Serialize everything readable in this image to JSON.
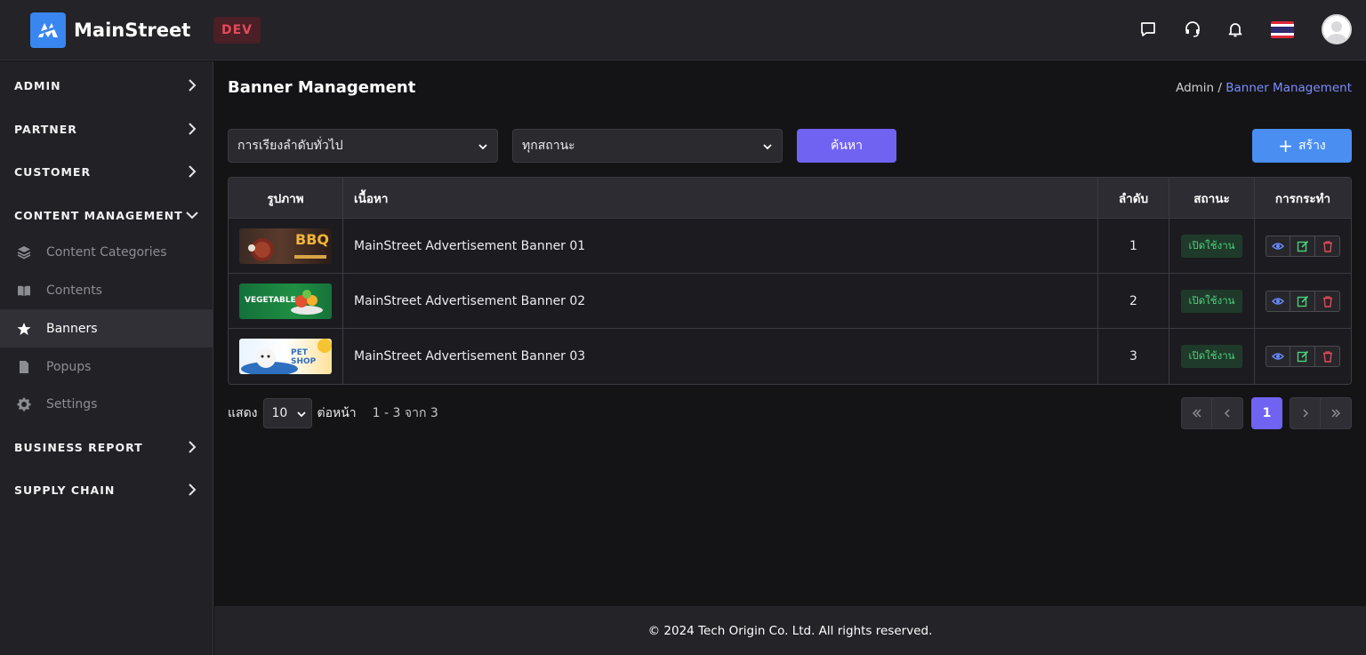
{
  "brand": {
    "name": "MainStreet",
    "env": "DEV"
  },
  "sidebar": {
    "groups": {
      "admin": "ADMIN",
      "partner": "PARTNER",
      "customer": "CUSTOMER",
      "content": "CONTENT MANAGEMENT",
      "business": "BUSINESS REPORT",
      "supply": "SUPPLY CHAIN"
    },
    "items": [
      {
        "label": "Content Categories",
        "icon": "layers-icon"
      },
      {
        "label": "Contents",
        "icon": "book-icon"
      },
      {
        "label": "Banners",
        "icon": "star-icon",
        "active": true
      },
      {
        "label": "Popups",
        "icon": "file-icon"
      },
      {
        "label": "Settings",
        "icon": "gear-icon"
      }
    ]
  },
  "page": {
    "title": "Banner Management",
    "breadcrumb": {
      "root": "Admin",
      "sep": "/",
      "current": "Banner Management"
    }
  },
  "filters": {
    "sort": "การเรียงลำดับทั่วไป",
    "status": "ทุกสถานะ",
    "search_label": "ค้นหา",
    "create_label": "สร้าง"
  },
  "table": {
    "headers": {
      "image": "รูปภาพ",
      "content": "เนื้อหา",
      "order": "ลำดับ",
      "status": "สถานะ",
      "actions": "การกระทำ"
    },
    "rows": [
      {
        "thumb": "BBQ",
        "content": "MainStreet Advertisement Banner 01",
        "order": "1",
        "status": "เปิดใช้งาน"
      },
      {
        "thumb": "VEGETABLE",
        "content": "MainStreet Advertisement Banner 02",
        "order": "2",
        "status": "เปิดใช้งาน"
      },
      {
        "thumb": "PET SHOP",
        "content": "MainStreet Advertisement Banner 03",
        "order": "3",
        "status": "เปิดใช้งาน"
      }
    ]
  },
  "pagination": {
    "show_label": "แสดง",
    "per_page": "10",
    "per_page_suffix": "ต่อหน้า",
    "range": "1 - 3 จาก 3",
    "current_page": "1"
  },
  "footer": {
    "text": "© 2024 Tech Origin Co. Ltd. All rights reserved."
  },
  "colors": {
    "accent": "#7163f2",
    "primary": "#4a8ef2",
    "success": "#4cd07a",
    "danger": "#e04b5a"
  }
}
